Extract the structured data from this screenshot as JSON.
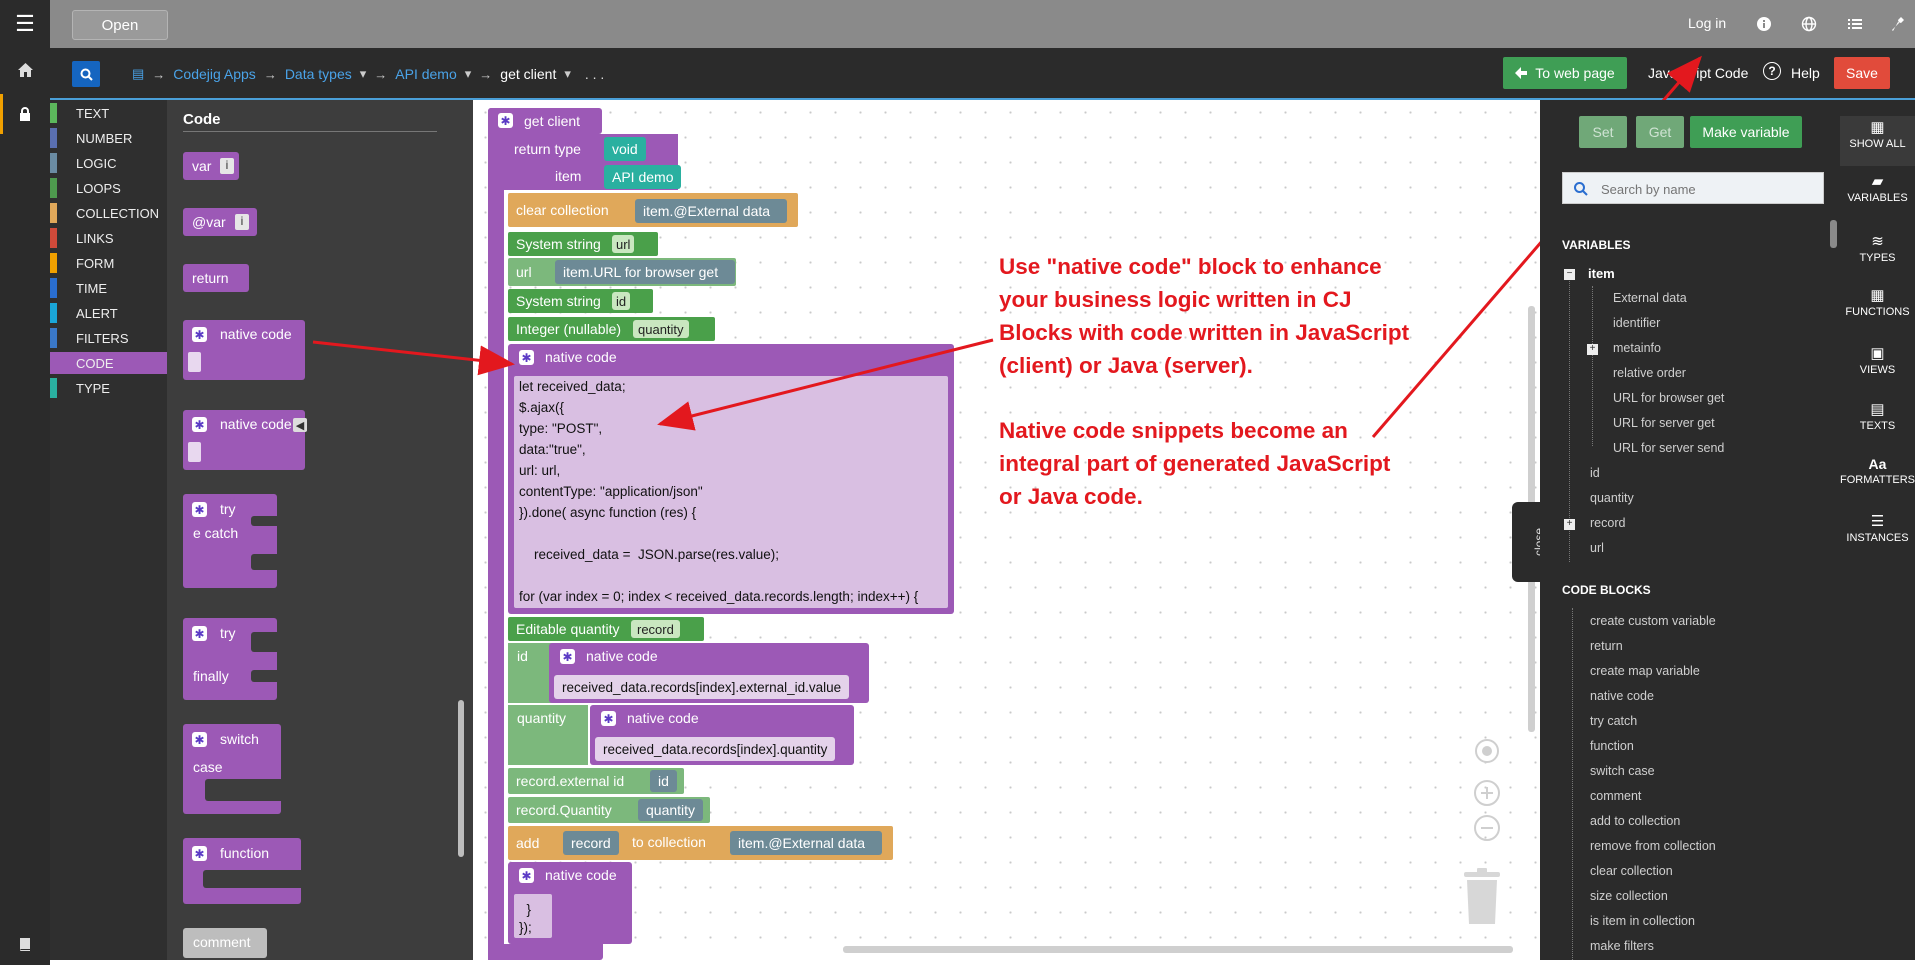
{
  "topbar": {
    "open_label": "Open",
    "login_label": "Log in"
  },
  "breadcrumb": {
    "items": [
      "Codejig Apps",
      "Data types",
      "API demo",
      "get client"
    ],
    "more": ". . ."
  },
  "toolbar": {
    "to_web_page": "To web page",
    "javascript_code": "Javascript Code",
    "help": "Help",
    "save": "Save"
  },
  "categories": [
    {
      "label": "TEXT",
      "color": "#5cb85c"
    },
    {
      "label": "NUMBER",
      "color": "#5a6fb0"
    },
    {
      "label": "LOGIC",
      "color": "#6b8ca3"
    },
    {
      "label": "LOOPS",
      "color": "#4e9a4e"
    },
    {
      "label": "COLLECTION",
      "color": "#e0a85a"
    },
    {
      "label": "LINKS",
      "color": "#d04a3a"
    },
    {
      "label": "FORM",
      "color": "#f0a000"
    },
    {
      "label": "TIME",
      "color": "#2a6ed0"
    },
    {
      "label": "ALERT",
      "color": "#1aa6d8"
    },
    {
      "label": "FILTERS",
      "color": "#3a78c8"
    },
    {
      "label": "CODE",
      "color": "#9c59b6"
    },
    {
      "label": "TYPE",
      "color": "#2ab0a0"
    }
  ],
  "palette": {
    "title": "Code",
    "var": "var",
    "var_i": "i",
    "atvar": "@var",
    "atvar_i": "i",
    "return": "return",
    "native_code_1": "native code",
    "native_code_2": "native code",
    "try_catch_1": "try",
    "try_catch_2": "e   catch",
    "try_finally_1": "try",
    "try_finally_2": "finally",
    "switch_1": "switch",
    "switch_2": "case",
    "function": "function",
    "comment": "comment",
    "close": "close"
  },
  "workspace": {
    "fn_name": "get client",
    "return_type_label": "return type",
    "return_type_value": "void",
    "item_label": "item",
    "item_value": "API demo",
    "clear_collection": "clear collection",
    "clear_collection_arg": "item.@External data",
    "system_string_url": "System string",
    "url_badge": "url",
    "url_label": "url",
    "url_value": "item.URL for browser get",
    "system_string_id": "System string",
    "id_badge": "id",
    "integer_nullable": "Integer (nullable)",
    "quantity_badge": "quantity",
    "native_code_main": "native code",
    "code_lines": [
      "let received_data;",
      "$.ajax({",
      "type: \"POST\",",
      "data:\"true\",",
      "url: url,",
      "contentType: \"application/json\"",
      "}).done( async function (res) {",
      "",
      "    received_data =  JSON.parse(res.value);",
      "",
      "for (var index = 0; index < received_data.records.length; index++) {"
    ],
    "editable_quantity": "Editable quantity",
    "record_badge": "record",
    "id_label": "id",
    "native_code_id": "native code",
    "id_expr": "received_data.records[index].external_id.value",
    "quantity_label": "quantity",
    "native_code_qty": "native code",
    "qty_expr": "received_data.records[index].quantity",
    "record_external_id": "record.external id",
    "ext_id_value": "id",
    "record_quantity": "record.Quantity",
    "rq_value": "quantity",
    "add_label": "add",
    "add_record": "record",
    "to_collection": "to collection",
    "add_target": "item.@External data",
    "native_code_end": "native code",
    "end_lines": [
      "  }",
      "});"
    ],
    "close": "close"
  },
  "callout": {
    "lines1": [
      "Use \"native code\" block to enhance",
      "your business logic written in CJ",
      "Blocks with code written in JavaScript",
      "(client) or Java (server)."
    ],
    "lines2": [
      "Native code snippets become an",
      "integral part of generated JavaScript",
      "or Java code."
    ]
  },
  "right": {
    "set": "Set",
    "get": "Get",
    "make_variable": "Make variable",
    "search_placeholder": "Search by name",
    "variables_title": "VARIABLES",
    "item": "item",
    "item_children": [
      "External data",
      "identifier",
      "metainfo",
      "relative order",
      "URL for browser get",
      "URL for server get",
      "URL for server send"
    ],
    "vars": [
      "id",
      "quantity",
      "record",
      "url"
    ],
    "code_blocks_title": "CODE BLOCKS",
    "code_blocks": [
      "create custom variable",
      "return",
      "create map variable",
      "native code",
      "try catch",
      "function",
      "switch case",
      "comment",
      "add to collection",
      "remove from collection",
      "clear collection",
      "size collection",
      "is item in collection",
      "make filters"
    ]
  },
  "sidenav": [
    "SHOW ALL",
    "VARIABLES",
    "TYPES",
    "FUNCTIONS",
    "VIEWS",
    "TEXTS",
    "FORMATTERS",
    "INSTANCES"
  ],
  "colors": {
    "procedure": "#9c59b6",
    "variable_green": "#4aa04a",
    "collection": "#e0a85a",
    "value_gray": "#6d8a96",
    "type_teal": "#2ab0a0",
    "callout_red": "#e3181e",
    "save_red": "#e14b3b",
    "to_web_green": "#3f9e55"
  },
  "icons": [
    "hamburger-icon",
    "info-icon",
    "globe-icon",
    "list-icon",
    "wrench-icon",
    "home-icon",
    "lock-icon",
    "book-icon",
    "search-icon",
    "help-icon",
    "arrow-left-icon",
    "gear-icon",
    "grid-icon",
    "target-icon",
    "zoom-in-icon",
    "zoom-out-icon",
    "trash-icon"
  ]
}
